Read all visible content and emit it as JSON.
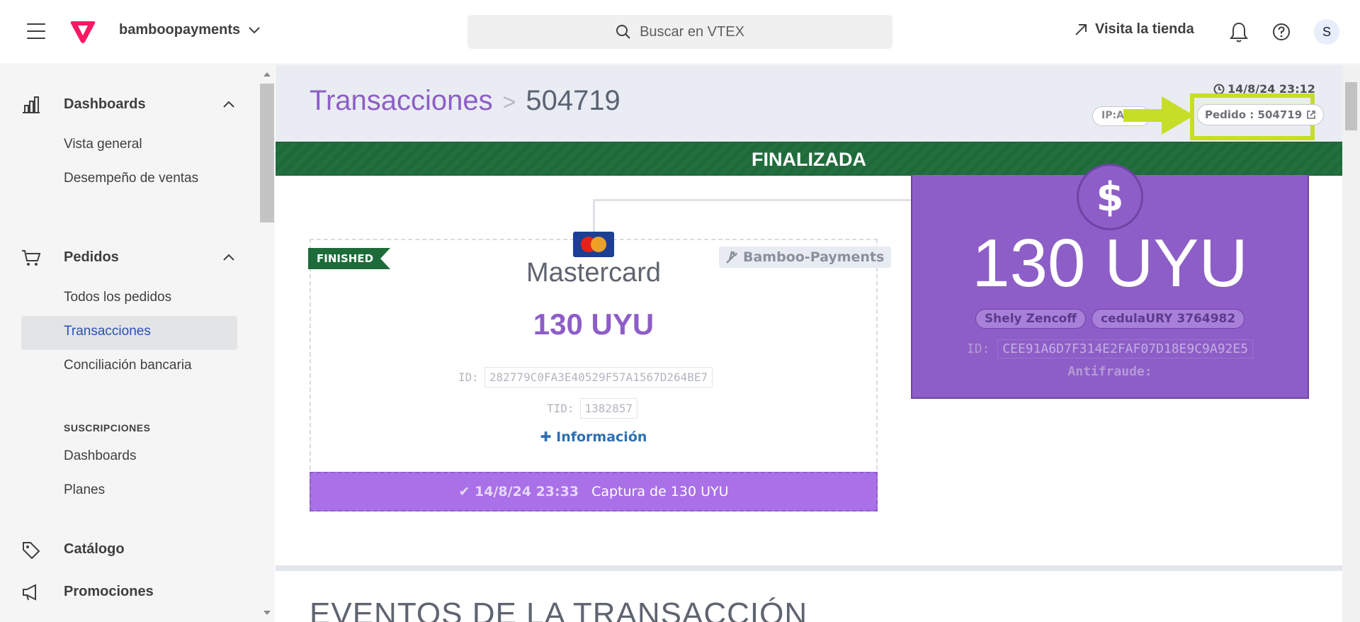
{
  "topbar": {
    "account": "bamboopayments",
    "search_placeholder": "Buscar en VTEX",
    "visit_store": "Visita la tienda",
    "avatar_letter": "S"
  },
  "sidebar": {
    "sections": [
      {
        "label": "Dashboards",
        "icon": "bar-chart-icon"
      },
      {
        "label": "Pedidos",
        "icon": "cart-icon"
      },
      {
        "label": "Catálogo",
        "icon": "tag-icon"
      },
      {
        "label": "Promociones",
        "icon": "megaphone-icon"
      }
    ],
    "dashboards_items": [
      "Vista general",
      "Desempeño de ventas"
    ],
    "pedidos_items": [
      "Todos los pedidos",
      "Transacciones",
      "Conciliación bancaria"
    ],
    "subscriptions_heading": "SUSCRIPCIONES",
    "subscriptions_items": [
      "Dashboards",
      "Planes"
    ]
  },
  "main": {
    "breadcrumb_root": "Transacciones",
    "breadcrumb_sep": ">",
    "breadcrumb_current": "504719",
    "timestamp": "14/8/24 23:12",
    "ip_label": "IP:Ac...",
    "order_link": "Pedido : 504719",
    "status": "FINALIZADA",
    "payment": {
      "ribbon": "FINISHED",
      "connector": "Bamboo-Payments",
      "method": "Mastercard",
      "amount": "130 UYU",
      "id_label": "ID:",
      "id_value": "282779C0FA3E40529F57A1567D264BE7",
      "tid_label": "TID:",
      "tid_value": "1382857",
      "more_info": "Información",
      "capture_time": "14/8/24 23:33",
      "capture_text": "Captura de  130 UYU"
    },
    "summary": {
      "currency_symbol": "$",
      "total": "130 UYU",
      "buyer": "Shely Zencoff",
      "document": "cedulaURY 3764982",
      "id_label": "ID:",
      "id_value": "CEE91A6D7F314E2FAF07D18E9C9A92E5",
      "antifraud_label": "Antifraude:"
    },
    "events_heading": "EVENTOS DE LA TRANSACCIÓN"
  },
  "colors": {
    "brand_purple": "#8d5ec7",
    "status_green": "#1e6b3a",
    "highlight": "#c6de27",
    "link_blue": "#2953b2"
  }
}
